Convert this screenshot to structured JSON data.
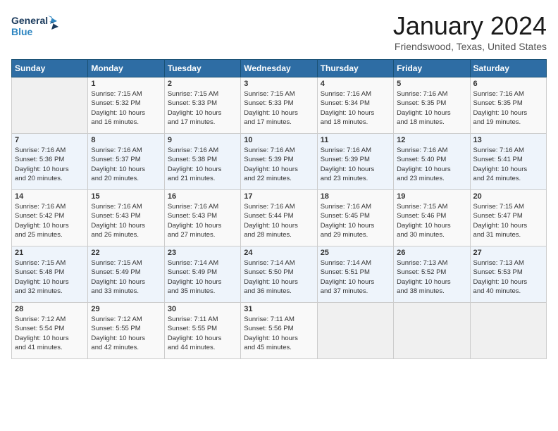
{
  "logo": {
    "line1": "General",
    "line2": "Blue"
  },
  "title": "January 2024",
  "location": "Friendswood, Texas, United States",
  "weekdays": [
    "Sunday",
    "Monday",
    "Tuesday",
    "Wednesday",
    "Thursday",
    "Friday",
    "Saturday"
  ],
  "weeks": [
    [
      {
        "day": "",
        "info": ""
      },
      {
        "day": "1",
        "info": "Sunrise: 7:15 AM\nSunset: 5:32 PM\nDaylight: 10 hours\nand 16 minutes."
      },
      {
        "day": "2",
        "info": "Sunrise: 7:15 AM\nSunset: 5:33 PM\nDaylight: 10 hours\nand 17 minutes."
      },
      {
        "day": "3",
        "info": "Sunrise: 7:15 AM\nSunset: 5:33 PM\nDaylight: 10 hours\nand 17 minutes."
      },
      {
        "day": "4",
        "info": "Sunrise: 7:16 AM\nSunset: 5:34 PM\nDaylight: 10 hours\nand 18 minutes."
      },
      {
        "day": "5",
        "info": "Sunrise: 7:16 AM\nSunset: 5:35 PM\nDaylight: 10 hours\nand 18 minutes."
      },
      {
        "day": "6",
        "info": "Sunrise: 7:16 AM\nSunset: 5:35 PM\nDaylight: 10 hours\nand 19 minutes."
      }
    ],
    [
      {
        "day": "7",
        "info": "Sunrise: 7:16 AM\nSunset: 5:36 PM\nDaylight: 10 hours\nand 20 minutes."
      },
      {
        "day": "8",
        "info": "Sunrise: 7:16 AM\nSunset: 5:37 PM\nDaylight: 10 hours\nand 20 minutes."
      },
      {
        "day": "9",
        "info": "Sunrise: 7:16 AM\nSunset: 5:38 PM\nDaylight: 10 hours\nand 21 minutes."
      },
      {
        "day": "10",
        "info": "Sunrise: 7:16 AM\nSunset: 5:39 PM\nDaylight: 10 hours\nand 22 minutes."
      },
      {
        "day": "11",
        "info": "Sunrise: 7:16 AM\nSunset: 5:39 PM\nDaylight: 10 hours\nand 23 minutes."
      },
      {
        "day": "12",
        "info": "Sunrise: 7:16 AM\nSunset: 5:40 PM\nDaylight: 10 hours\nand 23 minutes."
      },
      {
        "day": "13",
        "info": "Sunrise: 7:16 AM\nSunset: 5:41 PM\nDaylight: 10 hours\nand 24 minutes."
      }
    ],
    [
      {
        "day": "14",
        "info": "Sunrise: 7:16 AM\nSunset: 5:42 PM\nDaylight: 10 hours\nand 25 minutes."
      },
      {
        "day": "15",
        "info": "Sunrise: 7:16 AM\nSunset: 5:43 PM\nDaylight: 10 hours\nand 26 minutes."
      },
      {
        "day": "16",
        "info": "Sunrise: 7:16 AM\nSunset: 5:43 PM\nDaylight: 10 hours\nand 27 minutes."
      },
      {
        "day": "17",
        "info": "Sunrise: 7:16 AM\nSunset: 5:44 PM\nDaylight: 10 hours\nand 28 minutes."
      },
      {
        "day": "18",
        "info": "Sunrise: 7:16 AM\nSunset: 5:45 PM\nDaylight: 10 hours\nand 29 minutes."
      },
      {
        "day": "19",
        "info": "Sunrise: 7:15 AM\nSunset: 5:46 PM\nDaylight: 10 hours\nand 30 minutes."
      },
      {
        "day": "20",
        "info": "Sunrise: 7:15 AM\nSunset: 5:47 PM\nDaylight: 10 hours\nand 31 minutes."
      }
    ],
    [
      {
        "day": "21",
        "info": "Sunrise: 7:15 AM\nSunset: 5:48 PM\nDaylight: 10 hours\nand 32 minutes."
      },
      {
        "day": "22",
        "info": "Sunrise: 7:15 AM\nSunset: 5:49 PM\nDaylight: 10 hours\nand 33 minutes."
      },
      {
        "day": "23",
        "info": "Sunrise: 7:14 AM\nSunset: 5:49 PM\nDaylight: 10 hours\nand 35 minutes."
      },
      {
        "day": "24",
        "info": "Sunrise: 7:14 AM\nSunset: 5:50 PM\nDaylight: 10 hours\nand 36 minutes."
      },
      {
        "day": "25",
        "info": "Sunrise: 7:14 AM\nSunset: 5:51 PM\nDaylight: 10 hours\nand 37 minutes."
      },
      {
        "day": "26",
        "info": "Sunrise: 7:13 AM\nSunset: 5:52 PM\nDaylight: 10 hours\nand 38 minutes."
      },
      {
        "day": "27",
        "info": "Sunrise: 7:13 AM\nSunset: 5:53 PM\nDaylight: 10 hours\nand 40 minutes."
      }
    ],
    [
      {
        "day": "28",
        "info": "Sunrise: 7:12 AM\nSunset: 5:54 PM\nDaylight: 10 hours\nand 41 minutes."
      },
      {
        "day": "29",
        "info": "Sunrise: 7:12 AM\nSunset: 5:55 PM\nDaylight: 10 hours\nand 42 minutes."
      },
      {
        "day": "30",
        "info": "Sunrise: 7:11 AM\nSunset: 5:55 PM\nDaylight: 10 hours\nand 44 minutes."
      },
      {
        "day": "31",
        "info": "Sunrise: 7:11 AM\nSunset: 5:56 PM\nDaylight: 10 hours\nand 45 minutes."
      },
      {
        "day": "",
        "info": ""
      },
      {
        "day": "",
        "info": ""
      },
      {
        "day": "",
        "info": ""
      }
    ]
  ]
}
